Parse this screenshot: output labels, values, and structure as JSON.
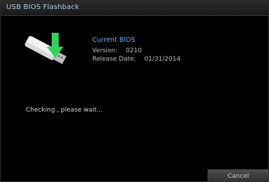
{
  "window": {
    "title": "USB BIOS Flashback"
  },
  "bios": {
    "heading": "Current BIOS",
    "version_label": "Version:",
    "version_value": "0210",
    "release_label": "Release Date:",
    "release_value": "01/31/2014"
  },
  "status": {
    "message": "Checking , please wait..."
  },
  "actions": {
    "cancel_label": "Cancel"
  },
  "icons": {
    "usb": "usb-drive-icon",
    "arrow": "download-arrow-icon"
  },
  "colors": {
    "background": "#000000",
    "title_text": "#b7c7d9",
    "accent": "#5ab0ff",
    "arrow_green": "#2fd15a"
  }
}
